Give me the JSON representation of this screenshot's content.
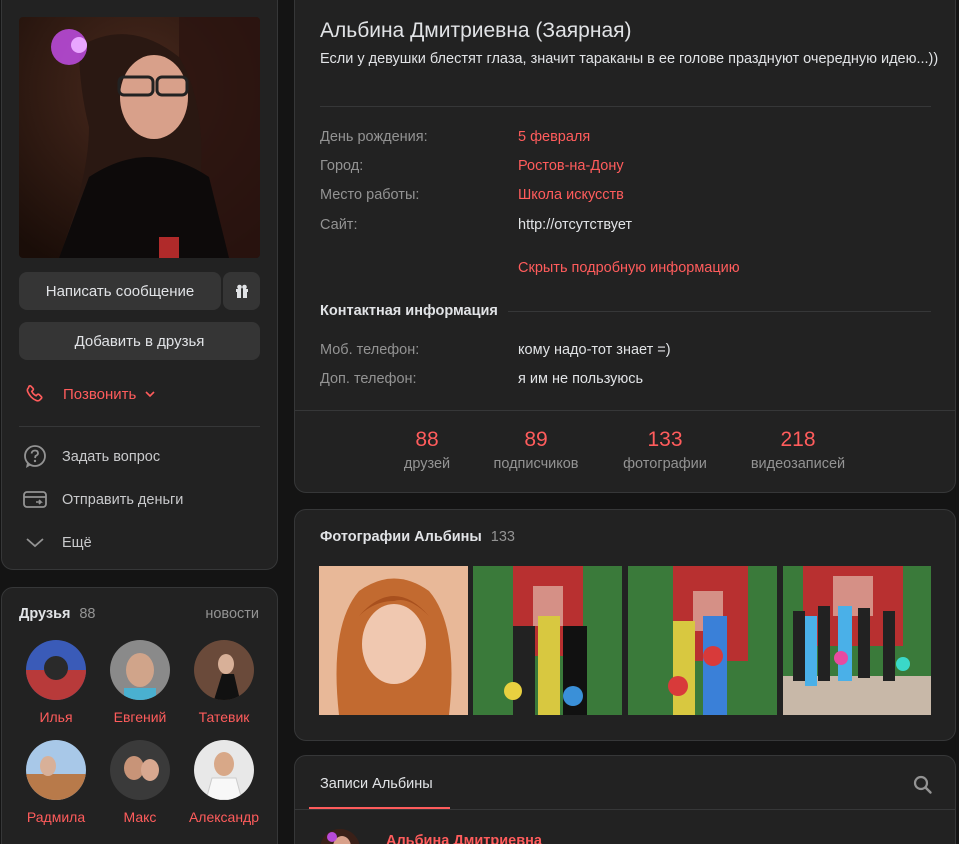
{
  "profile": {
    "message_button": "Написать сообщение",
    "add_friend_button": "Добавить в друзья",
    "call_label": "Позвонить",
    "actions": [
      {
        "label": "Задать вопрос",
        "icon": "question-icon"
      },
      {
        "label": "Отправить деньги",
        "icon": "money-card-icon"
      },
      {
        "label": "Ещё",
        "icon": "chevron-down-icon"
      }
    ]
  },
  "friends": {
    "title": "Друзья",
    "count": "88",
    "news_link": "новости",
    "items": [
      {
        "name": "Илья"
      },
      {
        "name": "Евгений"
      },
      {
        "name": "Татевик"
      },
      {
        "name": "Радмила"
      },
      {
        "name": "Макс"
      },
      {
        "name": "Александр"
      }
    ]
  },
  "info": {
    "name": "Альбина Дмитриевна (Заярная)",
    "status": "Если у девушки блестят глаза, значит тараканы в ее голове празднуют очередную идею...))",
    "rows": [
      {
        "label": "День рождения:",
        "value": "5 февраля"
      },
      {
        "label": "Город:",
        "value": "Ростов-на-Дону"
      },
      {
        "label": "Место работы:",
        "value": "Школа искусств"
      },
      {
        "label": "Сайт:",
        "value": "http://отсутствует"
      }
    ],
    "hide_link": "Скрыть подробную информацию",
    "contacts_title": "Контактная информация",
    "contacts": [
      {
        "label": "Моб. телефон:",
        "value": "кому надо-тот знает =)"
      },
      {
        "label": "Доп. телефон:",
        "value": "я им не пользуюсь"
      }
    ],
    "counters": [
      {
        "num": "88",
        "label": "друзей"
      },
      {
        "num": "89",
        "label": "подписчиков"
      },
      {
        "num": "133",
        "label": "фотографии"
      },
      {
        "num": "218",
        "label": "видеозаписей"
      }
    ]
  },
  "photos": {
    "title": "Фотографии Альбины",
    "count": "133"
  },
  "posts": {
    "tab": "Записи Альбины",
    "first_author": "Альбина Дмитриевна"
  },
  "colors": {
    "accent": "#ff5c5c",
    "card_bg": "#222222",
    "page_bg": "#141414"
  }
}
